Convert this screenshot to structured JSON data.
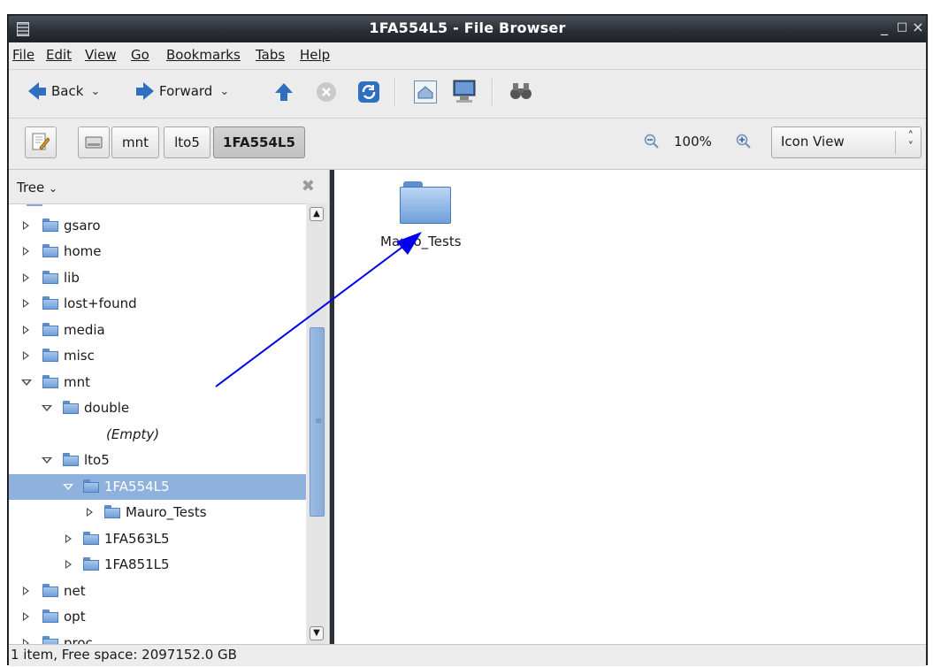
{
  "window": {
    "title": "1FA554L5 - File Browser",
    "controls": [
      "_",
      "□",
      "×"
    ]
  },
  "menu": [
    {
      "label": "File"
    },
    {
      "label": "Edit"
    },
    {
      "label": "View"
    },
    {
      "label": "Go"
    },
    {
      "label": "Bookmarks"
    },
    {
      "label": "Tabs"
    },
    {
      "label": "Help"
    }
  ],
  "toolbar": {
    "back_label": "Back",
    "forward_label": "Forward",
    "chevron": "⌄"
  },
  "path": {
    "segments": [
      "mnt",
      "lto5",
      "1FA554L5"
    ],
    "zoom": "100%",
    "view_mode": "Icon View"
  },
  "sidebar": {
    "header": "Tree",
    "tree": [
      {
        "label": "gsaro",
        "expanded": false
      },
      {
        "label": "home",
        "expanded": false
      },
      {
        "label": "lib",
        "expanded": false
      },
      {
        "label": "lost+found",
        "expanded": false
      },
      {
        "label": "media",
        "expanded": false
      },
      {
        "label": "misc",
        "expanded": false
      },
      {
        "label": "mnt",
        "expanded": true
      },
      {
        "label": "double",
        "expanded": true
      },
      {
        "label": "(Empty)"
      },
      {
        "label": "lto5",
        "expanded": true
      },
      {
        "label": "1FA554L5",
        "expanded": true,
        "selected": true
      },
      {
        "label": "Mauro_Tests",
        "expanded": false
      },
      {
        "label": "1FA563L5",
        "expanded": false
      },
      {
        "label": "1FA851L5",
        "expanded": false
      },
      {
        "label": "net",
        "expanded": false
      },
      {
        "label": "opt",
        "expanded": false
      },
      {
        "label": "proc",
        "expanded": false
      }
    ]
  },
  "main": {
    "items": [
      {
        "label": "Mauro_Tests",
        "icon": "folder-icon"
      }
    ]
  },
  "status": {
    "text": "1 item, Free space: 2097152.0 GB"
  },
  "colors": {
    "selection": "#8eb1de",
    "annotation_arrow": "#0000ee",
    "folder": "#6f9ed8"
  }
}
